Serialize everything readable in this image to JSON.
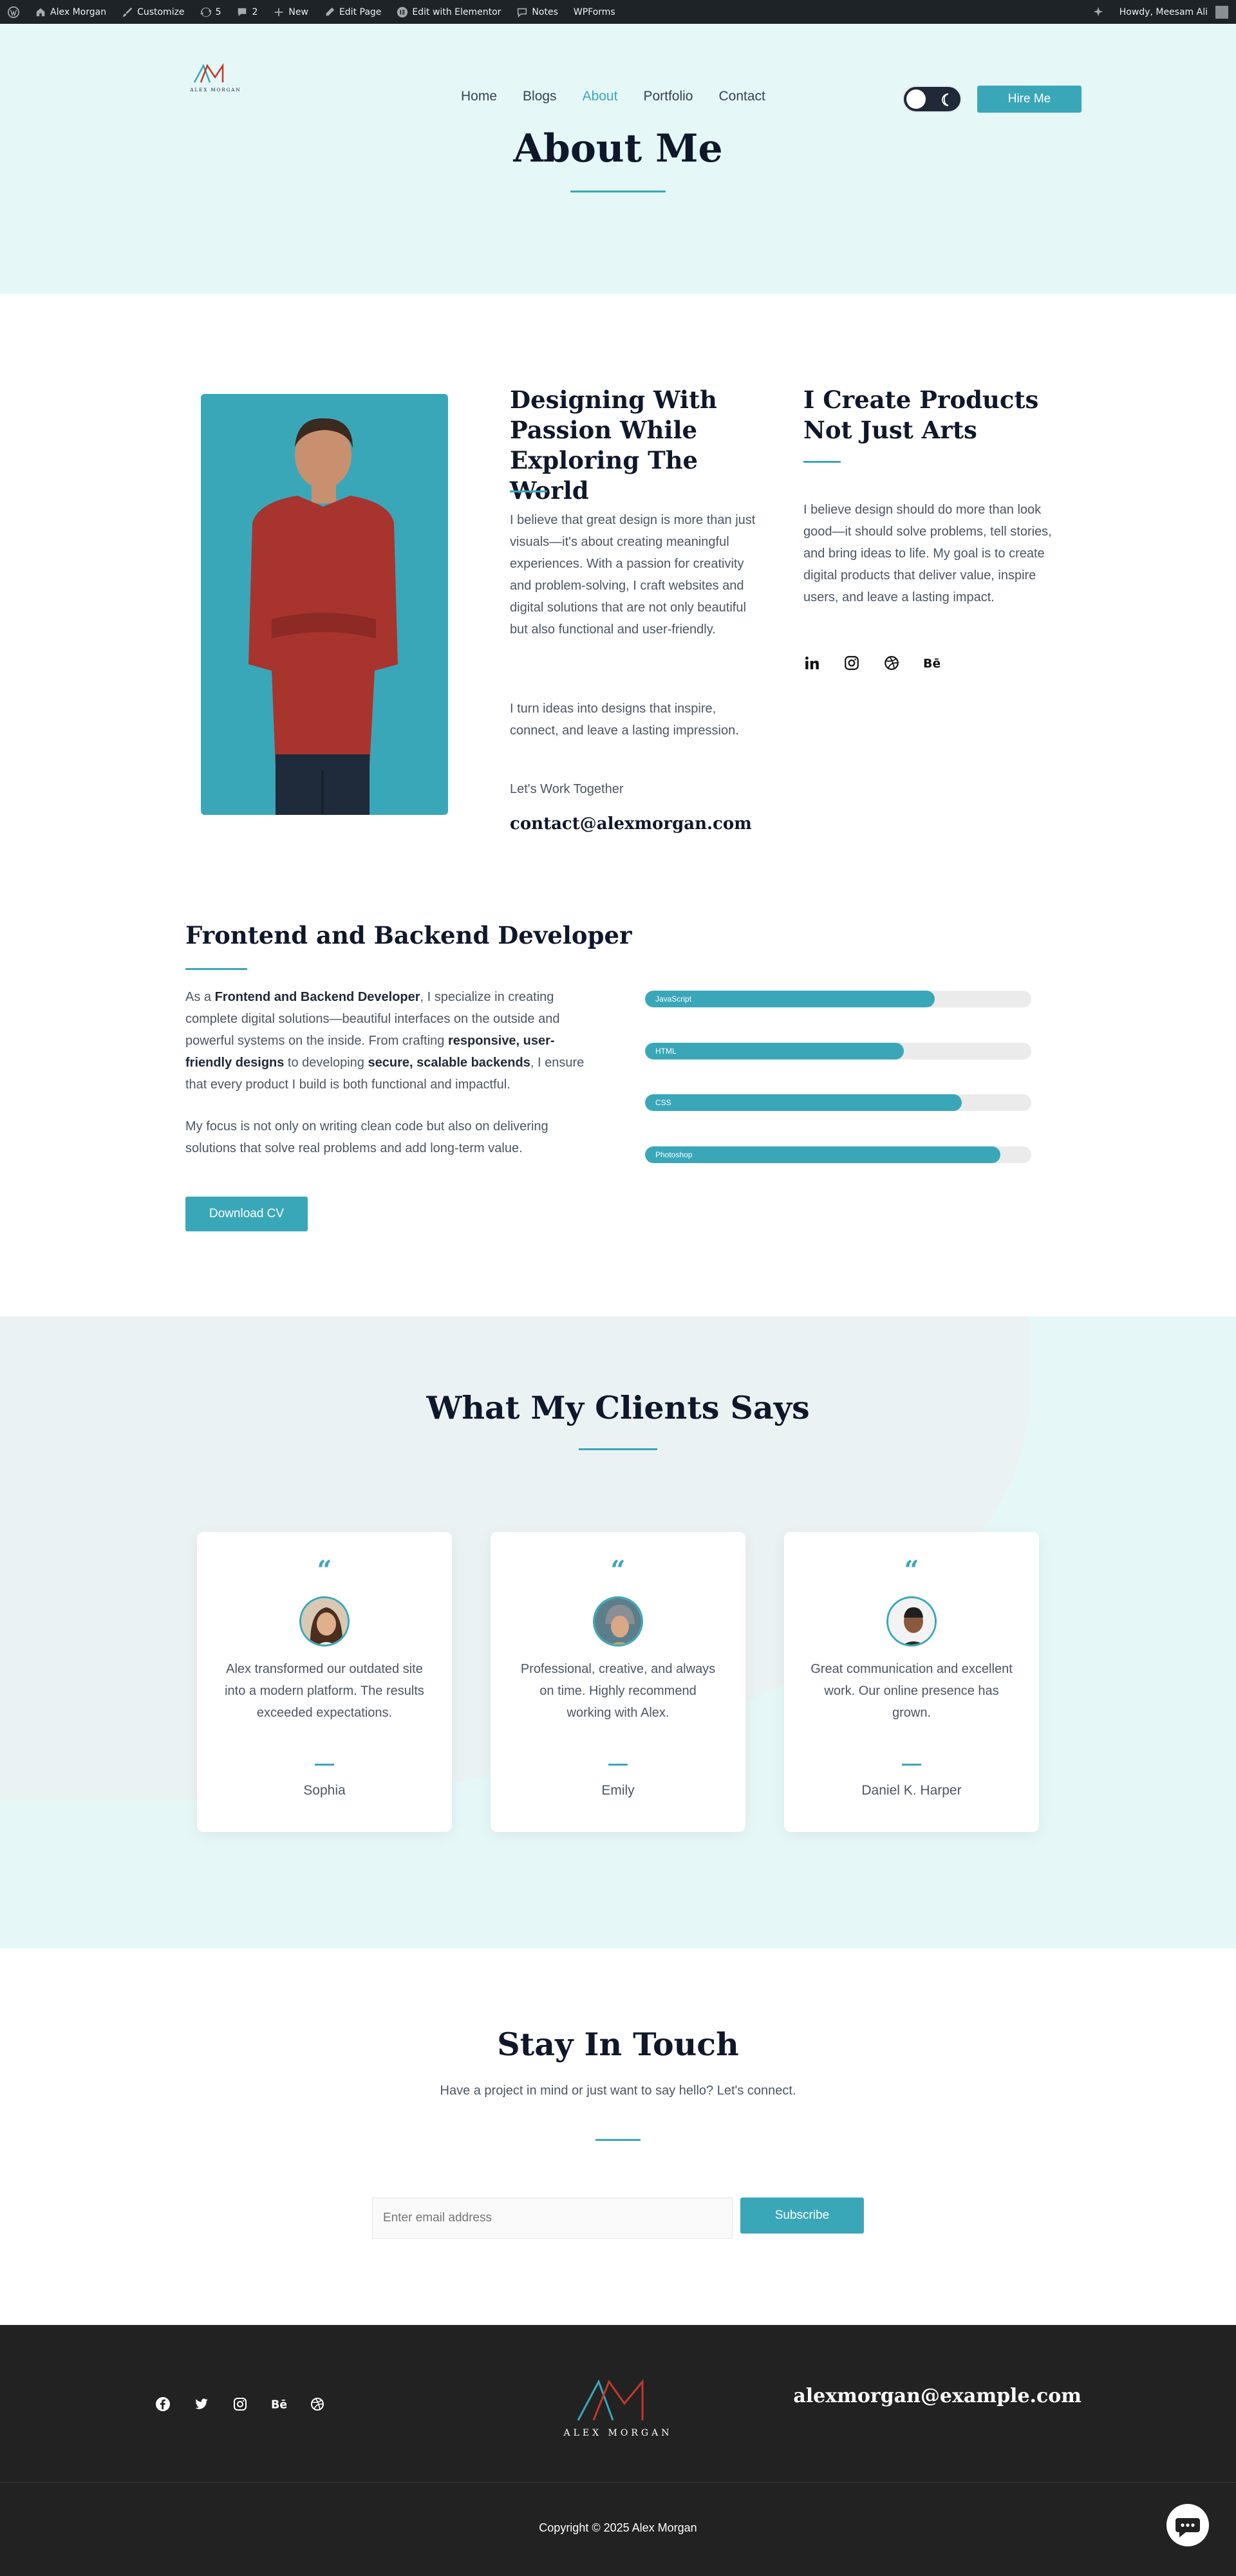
{
  "admin_bar": {
    "site_name": "Alex Morgan",
    "customize": "Customize",
    "updates": "5",
    "comments": "2",
    "new": "New",
    "edit_page": "Edit Page",
    "edit_elementor": "Edit with Elementor",
    "notes": "Notes",
    "wpforms": "WPForms",
    "greeting": "Howdy, Meesam Ali"
  },
  "header": {
    "logo_text": "ALEX MORGAN",
    "nav": [
      "Home",
      "Blogs",
      "About",
      "Portfolio",
      "Contact"
    ],
    "active_nav": "About",
    "hire_label": "Hire Me"
  },
  "hero": {
    "title": "About Me"
  },
  "intro": {
    "heading": "Designing With Passion While Exploring The World",
    "para1": "I believe that great design is more than just visuals—it's about creating meaningful experiences. With a passion for creativity and problem-solving, I craft websites and digital solutions that are not only beautiful but also functional and user-friendly.",
    "para2": "I turn ideas into designs that inspire, connect, and leave a lasting impression.",
    "work_label": "Let's Work Together",
    "email": "contact@alexmorgan.com"
  },
  "products": {
    "heading": "I Create Products Not Just Arts",
    "para": "I believe design should do more than look good—it should solve problems, tell stories, and bring ideas to life. My goal is to create digital products that deliver value, inspire users, and leave a lasting impact.",
    "socials": [
      "linkedin-icon",
      "instagram-icon",
      "dribbble-icon",
      "behance-icon"
    ]
  },
  "developer": {
    "heading": "Frontend and Backend Developer",
    "p1_a": "As a ",
    "p1_b": "Frontend and Backend Developer",
    "p1_c": ", I specialize in creating complete digital solutions—beautiful interfaces on the outside and powerful systems on the inside. From crafting ",
    "p1_d": "responsive, user-friendly designs",
    "p1_e": " to developing ",
    "p1_f": "secure, scalable backends",
    "p1_g": ", I ensure that every product I build is both functional and impactful.",
    "p2": "My focus is not only on writing clean code but also on delivering solutions that solve real problems and add long-term value.",
    "cv_label": "Download CV",
    "skills": [
      {
        "name": "JavaScript",
        "level": 0.75
      },
      {
        "name": "HTML",
        "level": 0.67
      },
      {
        "name": "CSS",
        "level": 0.82
      },
      {
        "name": "Photoshop",
        "level": 0.92
      }
    ]
  },
  "testimonials": {
    "title": "What My Clients Says",
    "quote_mark": "“",
    "items": [
      {
        "text": "Alex transformed our outdated site into a modern platform. The results exceeded expectations.",
        "name": "Sophia"
      },
      {
        "text": "Professional, creative, and always on time. Highly recommend working with Alex.",
        "name": "Emily"
      },
      {
        "text": "Great communication and excellent work. Our online presence has grown.",
        "name": "Daniel K. Harper"
      }
    ]
  },
  "newsletter": {
    "title": "Stay In Touch",
    "subtitle": "Have a project in mind or just want to say hello? Let's connect.",
    "placeholder": "Enter email address",
    "button": "Subscribe"
  },
  "footer": {
    "logo_text": "ALEX MORGAN",
    "email": "alexmorgan@example.com",
    "copyright": "Copyright © 2025 Alex Morgan",
    "socials": [
      "facebook-icon",
      "twitter-icon",
      "instagram-icon",
      "behance-icon",
      "dribbble-icon"
    ]
  },
  "colors": {
    "accent": "#3aa7b9",
    "hero_bg": "#e6f7f8",
    "footer_bg": "#222222",
    "admin_bg": "#1d2327"
  }
}
